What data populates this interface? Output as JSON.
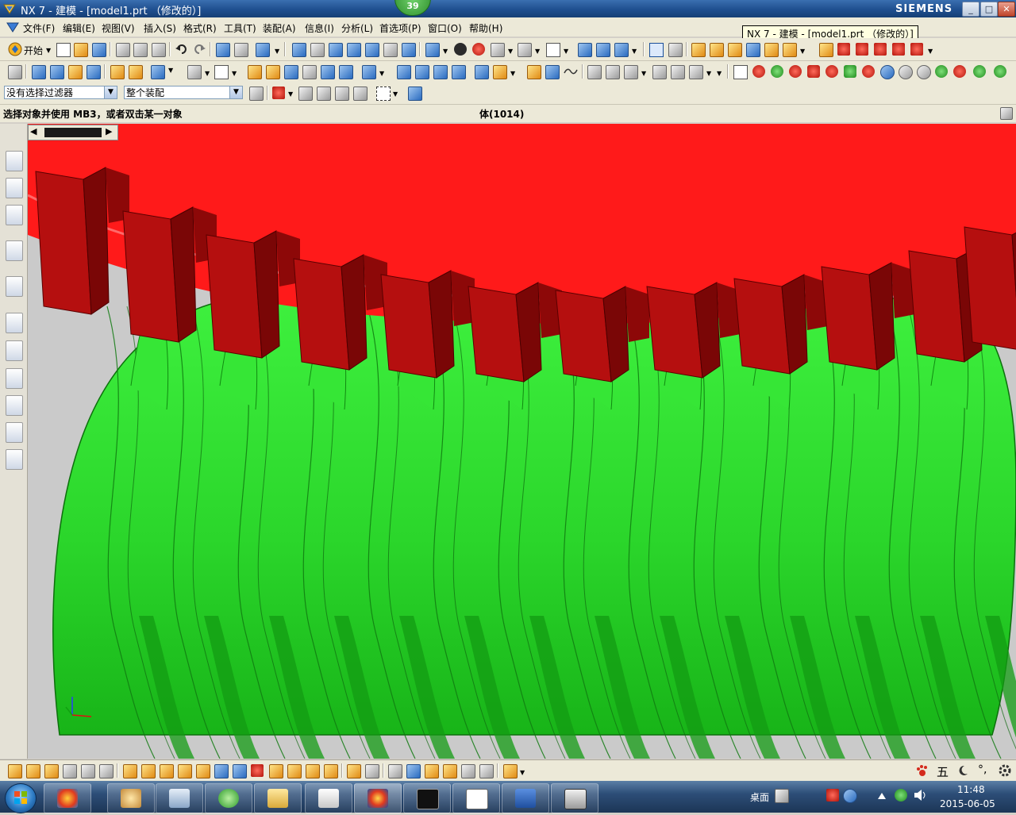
{
  "window": {
    "title": "NX 7 - 建模 - [model1.prt （修改的）]",
    "brand": "SIEMENS",
    "badge": "39",
    "min_btn": "_",
    "max_btn": "□",
    "close_btn": "✕"
  },
  "menu": {
    "items": [
      "文件(F)",
      "编辑(E)",
      "视图(V)",
      "插入(S)",
      "格式(R)",
      "工具(T)",
      "装配(A)",
      "信息(I)",
      "分析(L)",
      "首选项(P)",
      "窗口(O)",
      "帮助(H)"
    ],
    "tooltip": "NX 7 - 建模 - [model1.prt （修改的）]"
  },
  "toolbar": {
    "start_label": "开始",
    "filter_value": "没有选择过滤器",
    "assembly_value": "整个装配"
  },
  "cue": {
    "prompt": "选择对象并使用 MB3，或者双击某一对象",
    "status": "体(1014)"
  },
  "graphics": {
    "gear_color": "#ff1a1a",
    "worm_color": "#22dd22",
    "background": "#cacaca"
  },
  "bottom_right_icons": [
    "paw-icon",
    "wubi-icon",
    "moon-icon",
    "punct-icon",
    "gear-icon"
  ],
  "bottom_right_text": {
    "ime": "五"
  },
  "taskbar": {
    "tray_desktop": "桌面",
    "time": "11:48",
    "date": "2015-06-05"
  }
}
